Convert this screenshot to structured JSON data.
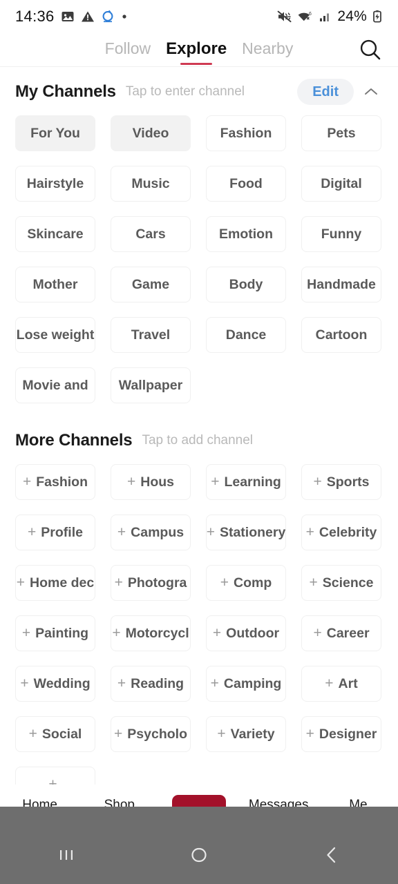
{
  "status_bar": {
    "time": "14:36",
    "battery_percent": "24%",
    "icons": [
      "image-icon",
      "warning-icon",
      "sync-icon",
      "dot-icon",
      "mute-icon",
      "wifi-icon",
      "signal-icon",
      "battery-charging-icon"
    ]
  },
  "top_tabs": {
    "items": [
      {
        "label": "Follow",
        "active": false
      },
      {
        "label": "Explore",
        "active": true
      },
      {
        "label": "Nearby",
        "active": false
      }
    ],
    "search_icon": "search-icon",
    "underline_color": "#cf3a52"
  },
  "my_channels": {
    "title": "My Channels",
    "subtitle": "Tap to enter channel",
    "edit_label": "Edit",
    "edit_color": "#4a90d9",
    "collapse_icon": "chevron-up-icon",
    "chips": [
      {
        "label": "For You",
        "selected": true
      },
      {
        "label": "Video",
        "selected": true
      },
      {
        "label": "Fashion",
        "selected": false
      },
      {
        "label": "Pets",
        "selected": false
      },
      {
        "label": "Hairstyle",
        "selected": false
      },
      {
        "label": "Music",
        "selected": false
      },
      {
        "label": "Food",
        "selected": false
      },
      {
        "label": "Digital",
        "selected": false
      },
      {
        "label": "Skincare",
        "selected": false
      },
      {
        "label": "Cars",
        "selected": false
      },
      {
        "label": "Emotion",
        "selected": false
      },
      {
        "label": "Funny",
        "selected": false
      },
      {
        "label": "Mother",
        "selected": false
      },
      {
        "label": "Game",
        "selected": false
      },
      {
        "label": "Body",
        "selected": false
      },
      {
        "label": "Handmade",
        "selected": false
      },
      {
        "label": "Lose weight",
        "selected": false
      },
      {
        "label": "Travel",
        "selected": false
      },
      {
        "label": "Dance",
        "selected": false
      },
      {
        "label": "Cartoon",
        "selected": false
      },
      {
        "label": "Movie and",
        "selected": false
      },
      {
        "label": "Wallpaper",
        "selected": false
      }
    ]
  },
  "more_channels": {
    "title": "More Channels",
    "subtitle": "Tap to add channel",
    "add_icon": "plus-icon",
    "chips": [
      {
        "label": "Fashion"
      },
      {
        "label": "Hous"
      },
      {
        "label": "Learning"
      },
      {
        "label": "Sports"
      },
      {
        "label": "Profile"
      },
      {
        "label": "Campus"
      },
      {
        "label": "Stationery"
      },
      {
        "label": "Celebrity"
      },
      {
        "label": "Home dec"
      },
      {
        "label": "Photogra"
      },
      {
        "label": "Comp"
      },
      {
        "label": "Science"
      },
      {
        "label": "Painting"
      },
      {
        "label": "Motorcycl"
      },
      {
        "label": "Outdoor"
      },
      {
        "label": "Career"
      },
      {
        "label": "Wedding"
      },
      {
        "label": "Reading"
      },
      {
        "label": "Camping"
      },
      {
        "label": "Art"
      },
      {
        "label": "Social"
      },
      {
        "label": "Psycholo"
      },
      {
        "label": "Variety"
      },
      {
        "label": "Designer"
      },
      {
        "label": ""
      }
    ]
  },
  "app_nav": {
    "items": [
      {
        "label": "Home"
      },
      {
        "label": "Shop"
      },
      {
        "label": ""
      },
      {
        "label": "Messages"
      },
      {
        "label": "Me"
      }
    ],
    "post_button_color": "#a3112a"
  },
  "system_nav": {
    "recents_icon": "recents-icon",
    "home_icon": "home-circle-icon",
    "back_icon": "back-chevron-icon"
  }
}
